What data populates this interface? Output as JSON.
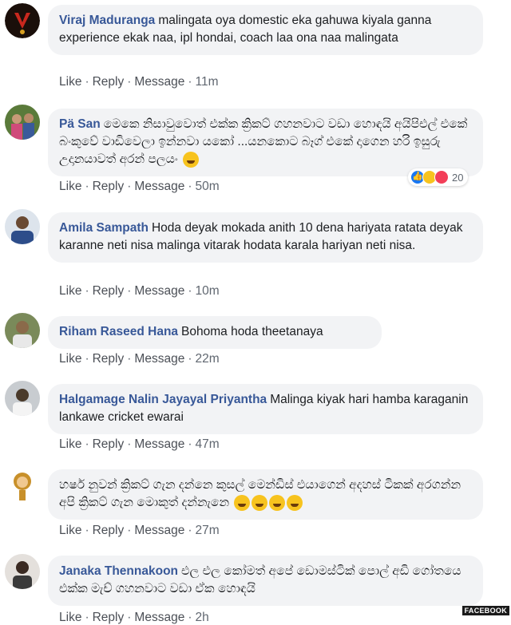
{
  "comments": [
    {
      "author": "Viraj Maduranga",
      "text": "malingata oya domestic eka gahuwa kiyala ganna experience ekak naa, ipl hondai, coach laa ona naa malingata",
      "like": "Like",
      "reply": "Reply",
      "message": "Message",
      "time": "11m"
    },
    {
      "author": "Pä San",
      "text": "මෙකෙ නිසාවුවොත් එක්ක ක්‍රිකට් ගහනවාට වඩා හොඳයි අයිපිඑල් එකේ බංකුවේ වාඩිවෙලා ඉන්නවා යකෝ ...යනකොට බෑග් එකේ දාගෙන හරි ඉසුරු උදානයාවත් අරන් පලයං",
      "like": "Like",
      "reply": "Reply",
      "message": "Message",
      "time": "50m",
      "reaction_count": "20"
    },
    {
      "author": "Amila Sampath",
      "text": "Hoda deyak mokada anith 10 dena hariyata ratata deyak karanne neti nisa malinga vitarak hodata karala hariyan neti nisa.",
      "like": "Like",
      "reply": "Reply",
      "message": "Message",
      "time": "10m"
    },
    {
      "author": "Riham Raseed Hana",
      "text": "Bohoma hoda theetanaya",
      "like": "Like",
      "reply": "Reply",
      "message": "Message",
      "time": "22m"
    },
    {
      "author": "Halgamage Nalin Jayayal Priyantha",
      "text": "Malinga kiyak hari hamba karaganin lankawe cricket ewarai",
      "like": "Like",
      "reply": "Reply",
      "message": "Message",
      "time": "47m"
    },
    {
      "author": "",
      "text": "හර්ෂ නුවන් ක්‍රිකට් ගැන දන්නෙ කුසල් මෙන්ඩිස් එයාගෙන් අදහස් ටිකක් අරගන්න අපි ක්‍රිකට් ගැන මොකුත් දන්නැනෙ",
      "like": "Like",
      "reply": "Reply",
      "message": "Message",
      "time": "27m"
    },
    {
      "author": "Janaka Thennakoon",
      "text": "එල එල කෝමත් අපේ ඩොමස්ටික් පොල් අඩි ගෝතයෙ එක්ක මැච් ගහනවාට වඩා ඒක හොඳයි",
      "like": "Like",
      "reply": "Reply",
      "message": "Message",
      "time": "2h"
    }
  ],
  "watermark": "FACEBOOK",
  "colors": {
    "author": "#385898",
    "bubble": "#f2f3f5",
    "meta": "#606770"
  }
}
